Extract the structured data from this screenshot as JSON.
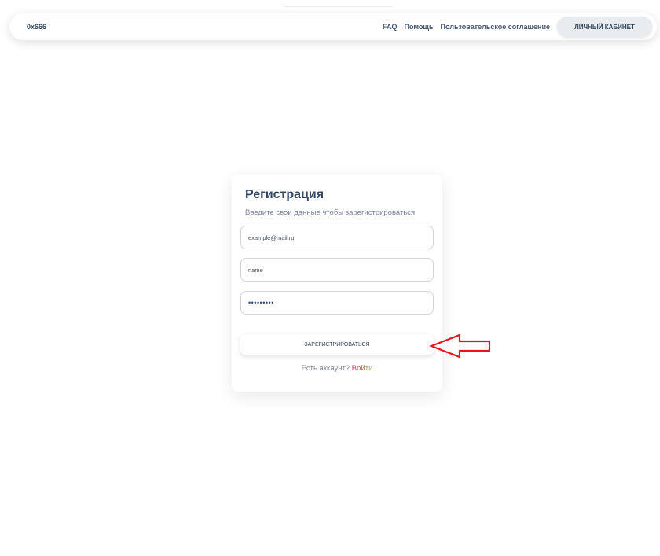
{
  "navbar": {
    "brand": "0x666",
    "links": [
      "FAQ",
      "Помощь",
      "Пользовательское соглашение"
    ],
    "cabinet_button": "ЛИЧНЫЙ КАБИНЕТ"
  },
  "card": {
    "title": "Регистрация",
    "subtitle": "Введите свои данные чтобы зарегистрироваться",
    "email_value": "example@mail.ru",
    "name_value": "name",
    "password_value": "•••••••••",
    "submit_label": "ЗАРЕГИСТРИРОВАТЬСЯ",
    "login_prompt": "Есть аккаунт?",
    "login_link": "Войти"
  },
  "colors": {
    "arrow": "#e8141e",
    "text_primary": "#344767",
    "text_muted": "#7b809a"
  },
  "icons": [
    "arrow-left-icon"
  ]
}
